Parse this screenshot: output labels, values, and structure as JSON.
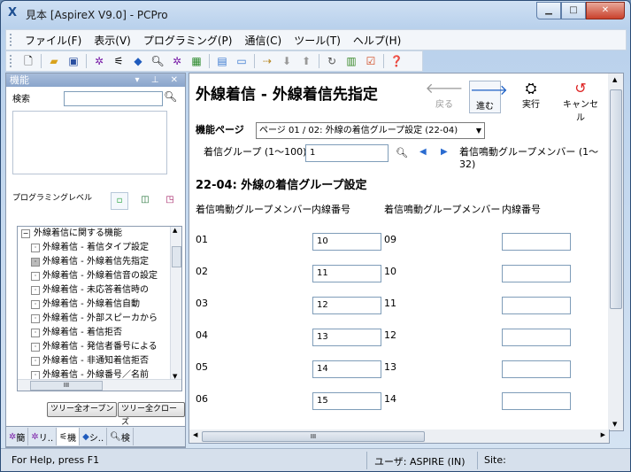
{
  "window": {
    "title": "見本 [AspireX V9.0] - PCPro",
    "app_icon": "X"
  },
  "menu": [
    "ファイル(F)",
    "表示(V)",
    "プログラミング(P)",
    "通信(C)",
    "ツール(T)",
    "ヘルプ(H)"
  ],
  "left_pane": {
    "title": "機能",
    "search_label": "検索",
    "search_value": "",
    "programming_level_label": "プログラミングレベル",
    "tree_root": "外線着信に関する機能",
    "tree_items": [
      "外線着信 - 着信タイプ設定",
      "外線着信 - 外線着信先指定",
      "外線着信 - 外線着信音の設定",
      "外線着信 - 未応答着信時の",
      "外線着信 - 外線着信自動",
      "外線着信 - 外部スピーカから",
      "外線着信 - 着信拒否",
      "外線着信 - 発信者番号による",
      "外線着信 - 非通知着信拒否",
      "外線着信 - 外線番号／名前"
    ],
    "selected_index": 1,
    "expand_all_button": "ツリー全オープン",
    "collapse_all_button": "ツリー全クローズ",
    "tabs": [
      "簡",
      "リ..",
      "機",
      "シ..",
      "検"
    ]
  },
  "main": {
    "title": "外線着信 - 外線着信先指定",
    "actions": {
      "back": "戻る",
      "forward": "進む",
      "run": "実行",
      "cancel": "キャンセル"
    },
    "feature_page_label": "機能ページ",
    "feature_page_value": "ページ 01 / 02: 外線の着信グループ設定 (22-04)",
    "group_label": "着信グループ (1〜100)",
    "group_value": "1",
    "member_label": "着信鳴動グループメンバー (1〜32)",
    "section_title": "22-04: 外線の着信グループ設定",
    "col_member": "着信鳴動グループメンバー",
    "col_ext": "内線番号",
    "left_rows": [
      {
        "member": "01",
        "ext": "10"
      },
      {
        "member": "02",
        "ext": "11"
      },
      {
        "member": "03",
        "ext": "12"
      },
      {
        "member": "04",
        "ext": "13"
      },
      {
        "member": "05",
        "ext": "14"
      },
      {
        "member": "06",
        "ext": "15"
      }
    ],
    "right_rows": [
      {
        "member": "09",
        "ext": ""
      },
      {
        "member": "10",
        "ext": ""
      },
      {
        "member": "11",
        "ext": ""
      },
      {
        "member": "12",
        "ext": ""
      },
      {
        "member": "13",
        "ext": ""
      },
      {
        "member": "14",
        "ext": ""
      }
    ]
  },
  "status": {
    "help": "For Help, press F1",
    "user": "ユーザ: ASPIRE (IN)",
    "site": "Site:"
  }
}
